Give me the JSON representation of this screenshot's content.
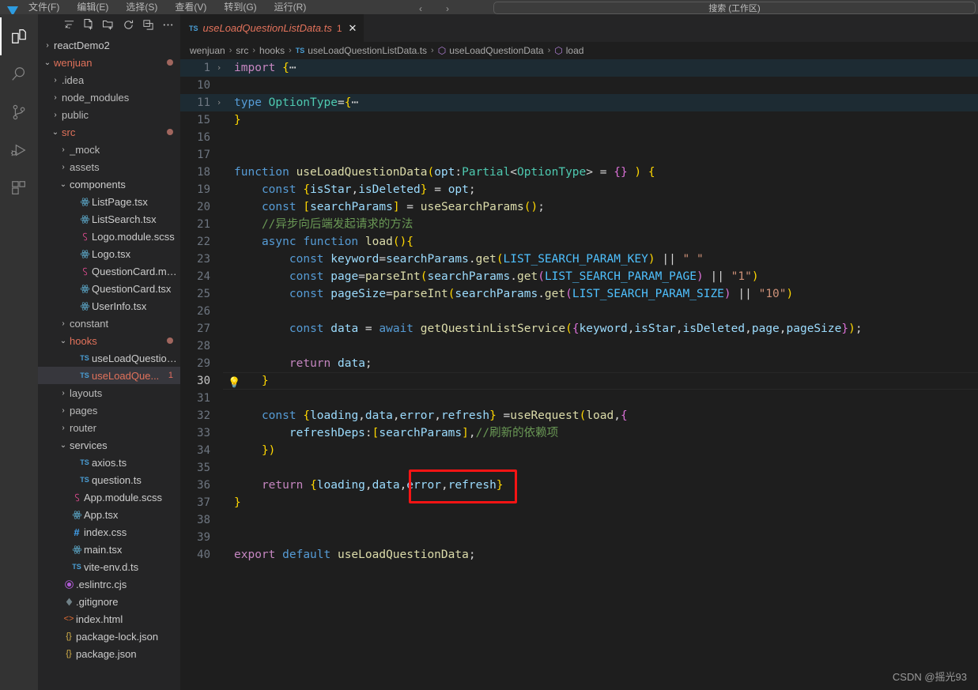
{
  "menubar": {
    "items": [
      "文件(F)",
      "编辑(E)",
      "选择(S)",
      "查看(V)",
      "转到(G)",
      "运行(R)"
    ],
    "nav_back": "‹",
    "nav_forward": "›",
    "command_center": "搜索 (工作区)"
  },
  "activitybar": {
    "items": [
      {
        "name": "explorer",
        "icon": "files-icon",
        "active": true
      },
      {
        "name": "search",
        "icon": "search-icon",
        "active": false
      },
      {
        "name": "source-control",
        "icon": "source-control-icon",
        "active": false
      },
      {
        "name": "run-debug",
        "icon": "run-debug-icon",
        "active": false
      },
      {
        "name": "extensions",
        "icon": "extensions-icon",
        "active": false
      }
    ]
  },
  "sidebar": {
    "toolbar": [
      {
        "name": "filter-icon",
        "glyph": "⚗"
      },
      {
        "name": "new-file-icon",
        "glyph": "new-file"
      },
      {
        "name": "new-folder-icon",
        "glyph": "new-folder"
      },
      {
        "name": "refresh-icon",
        "glyph": "↻"
      },
      {
        "name": "collapse-all-icon",
        "glyph": "collapse"
      },
      {
        "name": "more-actions-icon",
        "glyph": "⋯"
      }
    ],
    "tree": [
      {
        "label": "reactDemo2",
        "indent": 0,
        "twisty": "collapsed",
        "icon": "folder",
        "color": "default"
      },
      {
        "label": "wenjuan",
        "indent": 0,
        "twisty": "expanded",
        "icon": "folder",
        "color": "dirty",
        "dot": true
      },
      {
        "label": ".idea",
        "indent": 1,
        "twisty": "collapsed",
        "icon": "folder",
        "color": "mute"
      },
      {
        "label": "node_modules",
        "indent": 1,
        "twisty": "collapsed",
        "icon": "folder",
        "color": "mute"
      },
      {
        "label": "public",
        "indent": 1,
        "twisty": "collapsed",
        "icon": "folder",
        "color": "mute"
      },
      {
        "label": "src",
        "indent": 1,
        "twisty": "expanded",
        "icon": "folder",
        "color": "dirty",
        "dot": true
      },
      {
        "label": "_mock",
        "indent": 2,
        "twisty": "collapsed",
        "icon": "folder",
        "color": "mute"
      },
      {
        "label": "assets",
        "indent": 2,
        "twisty": "collapsed",
        "icon": "folder",
        "color": "mute"
      },
      {
        "label": "components",
        "indent": 2,
        "twisty": "expanded",
        "icon": "folder",
        "color": "default"
      },
      {
        "label": "ListPage.tsx",
        "indent": 3,
        "twisty": "none",
        "icon": "react",
        "color": "default"
      },
      {
        "label": "ListSearch.tsx",
        "indent": 3,
        "twisty": "none",
        "icon": "react",
        "color": "default"
      },
      {
        "label": "Logo.module.scss",
        "indent": 3,
        "twisty": "none",
        "icon": "scss",
        "color": "default"
      },
      {
        "label": "Logo.tsx",
        "indent": 3,
        "twisty": "none",
        "icon": "react",
        "color": "default"
      },
      {
        "label": "QuestionCard.mo...",
        "indent": 3,
        "twisty": "none",
        "icon": "scss",
        "color": "default"
      },
      {
        "label": "QuestionCard.tsx",
        "indent": 3,
        "twisty": "none",
        "icon": "react",
        "color": "default"
      },
      {
        "label": "UserInfo.tsx",
        "indent": 3,
        "twisty": "none",
        "icon": "react",
        "color": "default"
      },
      {
        "label": "constant",
        "indent": 2,
        "twisty": "collapsed",
        "icon": "folder",
        "color": "mute"
      },
      {
        "label": "hooks",
        "indent": 2,
        "twisty": "expanded",
        "icon": "folder",
        "color": "dirty",
        "dot": true
      },
      {
        "label": "useLoadQuestion...",
        "indent": 3,
        "twisty": "none",
        "icon": "ts",
        "color": "default"
      },
      {
        "label": "useLoadQue...",
        "indent": 3,
        "twisty": "none",
        "icon": "ts",
        "color": "dirty",
        "selected": true,
        "badge": "1"
      },
      {
        "label": "layouts",
        "indent": 2,
        "twisty": "collapsed",
        "icon": "folder",
        "color": "mute"
      },
      {
        "label": "pages",
        "indent": 2,
        "twisty": "collapsed",
        "icon": "folder",
        "color": "mute"
      },
      {
        "label": "router",
        "indent": 2,
        "twisty": "collapsed",
        "icon": "folder",
        "color": "mute"
      },
      {
        "label": "services",
        "indent": 2,
        "twisty": "expanded",
        "icon": "folder",
        "color": "default"
      },
      {
        "label": "axios.ts",
        "indent": 3,
        "twisty": "none",
        "icon": "ts",
        "color": "default"
      },
      {
        "label": "question.ts",
        "indent": 3,
        "twisty": "none",
        "icon": "ts",
        "color": "default"
      },
      {
        "label": "App.module.scss",
        "indent": 2,
        "twisty": "none",
        "icon": "scss",
        "color": "default"
      },
      {
        "label": "App.tsx",
        "indent": 2,
        "twisty": "none",
        "icon": "react",
        "color": "default"
      },
      {
        "label": "index.css",
        "indent": 2,
        "twisty": "none",
        "icon": "css",
        "color": "default"
      },
      {
        "label": "main.tsx",
        "indent": 2,
        "twisty": "none",
        "icon": "react",
        "color": "default"
      },
      {
        "label": "vite-env.d.ts",
        "indent": 2,
        "twisty": "none",
        "icon": "ts",
        "color": "default"
      },
      {
        "label": ".eslintrc.cjs",
        "indent": 1,
        "twisty": "none",
        "icon": "eslint",
        "color": "default"
      },
      {
        "label": ".gitignore",
        "indent": 1,
        "twisty": "none",
        "icon": "git",
        "color": "default"
      },
      {
        "label": "index.html",
        "indent": 1,
        "twisty": "none",
        "icon": "html",
        "color": "default"
      },
      {
        "label": "package-lock.json",
        "indent": 1,
        "twisty": "none",
        "icon": "json",
        "color": "default"
      },
      {
        "label": "package.json",
        "indent": 1,
        "twisty": "none",
        "icon": "json",
        "color": "default"
      }
    ]
  },
  "editor": {
    "tab": {
      "icon": "ts-file-icon",
      "label": "useLoadQuestionListData.ts",
      "error_count": "1",
      "close": "✕"
    },
    "breadcrumbs": [
      {
        "label": "wenjuan",
        "icon": "none"
      },
      {
        "label": "src",
        "icon": "none"
      },
      {
        "label": "hooks",
        "icon": "none"
      },
      {
        "label": "useLoadQuestionListData.ts",
        "icon": "ts"
      },
      {
        "label": "useLoadQuestionData",
        "icon": "symbol"
      },
      {
        "label": "load",
        "icon": "symbol"
      }
    ],
    "separator": "›",
    "lines": [
      {
        "num": "1",
        "fold": "›",
        "state": "folded"
      },
      {
        "num": "10",
        "fold": "",
        "state": "normal"
      },
      {
        "num": "11",
        "fold": "›",
        "state": "folded"
      },
      {
        "num": "15",
        "fold": "",
        "state": "normal"
      },
      {
        "num": "16",
        "fold": "",
        "state": "normal"
      },
      {
        "num": "17",
        "fold": "",
        "state": "normal"
      },
      {
        "num": "18",
        "fold": "",
        "state": "normal"
      },
      {
        "num": "19",
        "fold": "",
        "state": "normal"
      },
      {
        "num": "20",
        "fold": "",
        "state": "normal"
      },
      {
        "num": "21",
        "fold": "",
        "state": "normal"
      },
      {
        "num": "22",
        "fold": "",
        "state": "normal"
      },
      {
        "num": "23",
        "fold": "",
        "state": "normal"
      },
      {
        "num": "24",
        "fold": "",
        "state": "normal"
      },
      {
        "num": "25",
        "fold": "",
        "state": "normal"
      },
      {
        "num": "26",
        "fold": "",
        "state": "normal"
      },
      {
        "num": "27",
        "fold": "",
        "state": "normal"
      },
      {
        "num": "28",
        "fold": "",
        "state": "normal"
      },
      {
        "num": "29",
        "fold": "",
        "state": "normal"
      },
      {
        "num": "30",
        "fold": "",
        "state": "current",
        "bulb": "💡"
      },
      {
        "num": "31",
        "fold": "",
        "state": "normal"
      },
      {
        "num": "32",
        "fold": "",
        "state": "normal"
      },
      {
        "num": "33",
        "fold": "",
        "state": "normal"
      },
      {
        "num": "34",
        "fold": "",
        "state": "normal"
      },
      {
        "num": "35",
        "fold": "",
        "state": "normal"
      },
      {
        "num": "36",
        "fold": "",
        "state": "normal"
      },
      {
        "num": "37",
        "fold": "",
        "state": "normal"
      },
      {
        "num": "38",
        "fold": "",
        "state": "normal"
      },
      {
        "num": "39",
        "fold": "",
        "state": "normal"
      },
      {
        "num": "40",
        "fold": "",
        "state": "normal"
      }
    ],
    "source_text": [
      "import {⋯",
      "",
      "type OptionType={⋯",
      "}",
      "",
      "",
      "function useLoadQuestionData(opt:Partial<OptionType> = {} ) {",
      "    const {isStar,isDeleted} = opt;",
      "    const [searchParams] = useSearchParams();",
      "    //异步向后端发起请求的方法",
      "    async function load(){",
      "        const keyword=searchParams.get(LIST_SEARCH_PARAM_KEY) || \" \"",
      "        const page=parseInt(searchParams.get(LIST_SEARCH_PARAM_PAGE) || \"1\")",
      "        const pageSize=parseInt(searchParams.get(LIST_SEARCH_PARAM_SIZE) || \"10\")",
      "",
      "        const data = await getQuestinListService({keyword,isStar,isDeleted,page,pageSize});",
      "",
      "        return data;",
      "    }",
      "",
      "    const {loading,data,error,refresh} =useRequest(load,{",
      "        refreshDeps:[searchParams],//刷新的依赖项",
      "    })",
      "",
      "    return {loading,data,error,refresh}",
      "}",
      "",
      "",
      "export default useLoadQuestionData;"
    ],
    "highlight_annotation": {
      "label": "refresh-highlight-box",
      "color": "#f61414",
      "target_text": ",refresh}"
    }
  },
  "watermark": {
    "text": "CSDN @摇光93"
  }
}
